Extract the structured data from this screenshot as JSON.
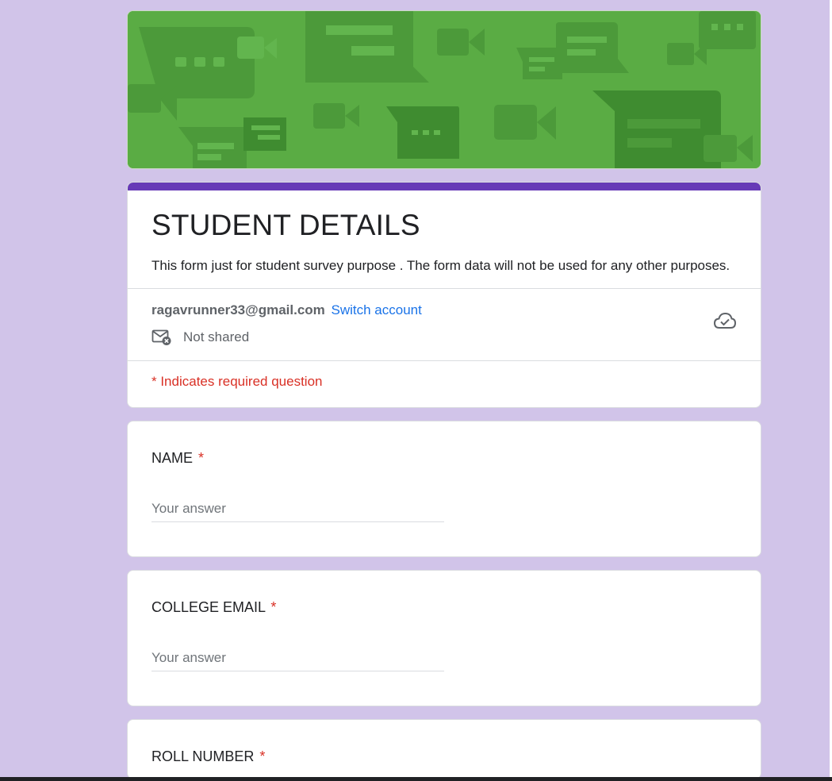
{
  "form": {
    "title": "STUDENT DETAILS",
    "description": "This form just for student survey purpose . The form data will not be used for any other purposes.",
    "accent_color": "#673ab7",
    "background_color": "#d1c4e9",
    "banner_color": "#5aac44"
  },
  "account": {
    "email": "ragavrunner33@gmail.com",
    "switch_label": "Switch account",
    "shared_status": "Not shared",
    "mail_icon": "mail-not-shared-icon",
    "cloud_icon": "cloud-saved-icon"
  },
  "required_note": "* Indicates required question",
  "questions": [
    {
      "label": "NAME",
      "required_mark": "*",
      "placeholder": "Your answer"
    },
    {
      "label": "COLLEGE EMAIL",
      "required_mark": "*",
      "placeholder": "Your answer"
    },
    {
      "label": "ROLL NUMBER",
      "required_mark": "*"
    }
  ]
}
